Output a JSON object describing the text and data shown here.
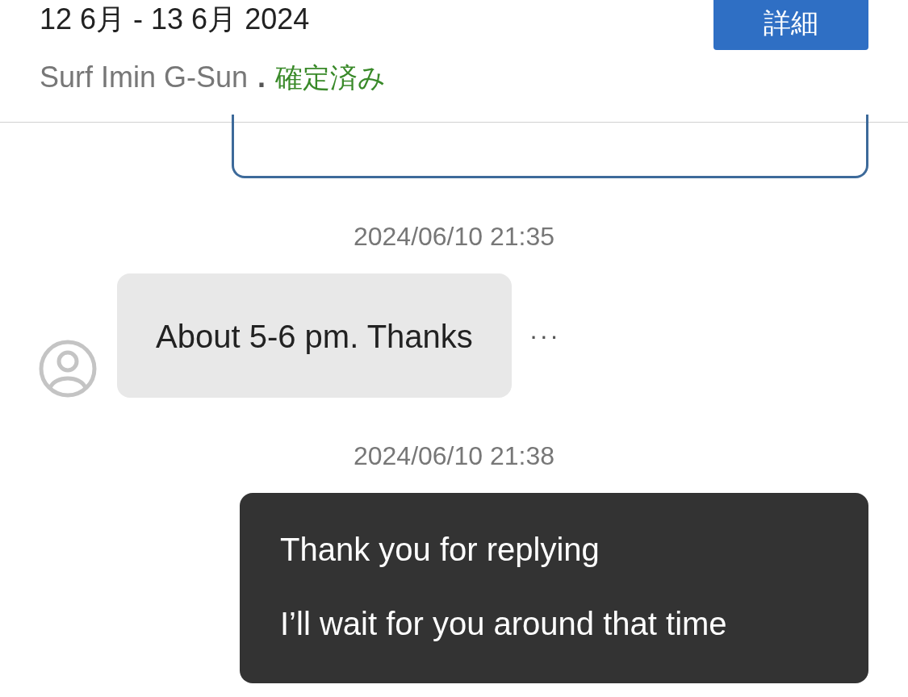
{
  "header": {
    "dates": "12 6月 - 13 6月 2024",
    "host": "Surf Imin G-Sun",
    "separator": ".",
    "status": "確定済み",
    "button": "詳細"
  },
  "messages": [
    {
      "kind": "card"
    },
    {
      "kind": "time",
      "text": "2024/06/10 21:35"
    },
    {
      "kind": "incoming",
      "lines": [
        "About 5-6 pm. Thanks"
      ],
      "more": "···"
    },
    {
      "kind": "time",
      "text": "2024/06/10 21:38"
    },
    {
      "kind": "outgoing",
      "lines": [
        "Thank you for replying",
        "I’ll wait for you around that time"
      ]
    }
  ]
}
